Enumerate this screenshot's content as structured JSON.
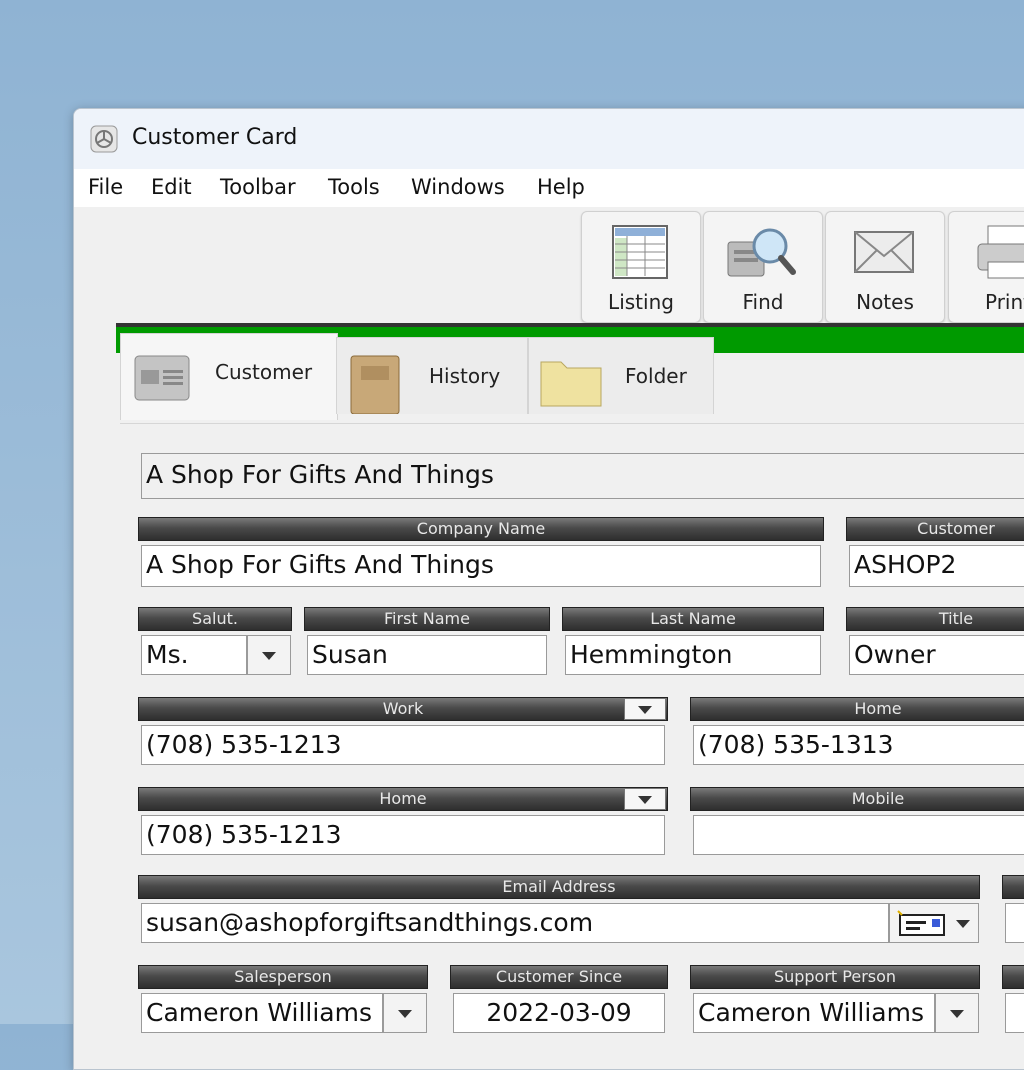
{
  "window": {
    "title": "Customer Card"
  },
  "menu": [
    "File",
    "Edit",
    "Toolbar",
    "Tools",
    "Windows",
    "Help"
  ],
  "toolbar": {
    "listing": "Listing",
    "find": "Find",
    "notes": "Notes",
    "print": "Print"
  },
  "tabs": {
    "customer": "Customer",
    "history": "History",
    "folder": "Folder"
  },
  "colors": {
    "accent_bar": "#009a00",
    "header_bg": "#3c3c3c"
  },
  "form": {
    "display_name": "A Shop For Gifts And Things",
    "labels": {
      "company_name": "Company Name",
      "customer_id": "Customer",
      "salutation": "Salut.",
      "first_name": "First Name",
      "last_name": "Last Name",
      "title": "Title",
      "work": "Work",
      "home_right": "Home",
      "home_left": "Home",
      "mobile": "Mobile",
      "email": "Email Address",
      "salesperson": "Salesperson",
      "customer_since": "Customer Since",
      "support_person": "Support Person"
    },
    "company_name": "A Shop For Gifts And Things",
    "customer_id": "ASHOP2",
    "salutation": "Ms.",
    "first_name": "Susan",
    "last_name": "Hemmington",
    "title": "Owner",
    "work_phone": "(708) 535-1213",
    "home_phone_right": "(708) 535-1313",
    "home_phone_left": "(708) 535-1213",
    "mobile": "",
    "email": "susan@ashopforgiftsandthings.com",
    "salesperson": "Cameron Williams",
    "customer_since": "2022-03-09",
    "support_person": "Cameron Williams"
  }
}
